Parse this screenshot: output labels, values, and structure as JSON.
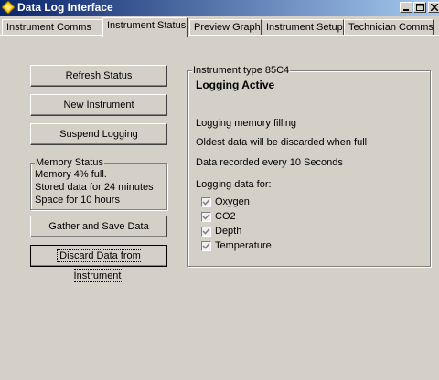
{
  "window": {
    "title": "Data Log Interface",
    "title_bar_color": "#0a246a"
  },
  "tabs": [
    {
      "label": "Instrument Comms",
      "active": false
    },
    {
      "label": "Instrument Status",
      "active": true
    },
    {
      "label": "Preview Graph",
      "active": false
    },
    {
      "label": "Instrument Setup",
      "active": false
    },
    {
      "label": "Technician Comms",
      "active": false
    }
  ],
  "buttons": {
    "refresh": "Refresh Status",
    "new_instrument": "New Instrument",
    "suspend": "Suspend Logging",
    "gather": "Gather and Save Data",
    "discard": "Discard Data from Instrument"
  },
  "memory_status": {
    "title": "Memory Status",
    "lines": [
      "Memory 4% full.",
      "Stored data for 24 minutes",
      "Space for 10 hours"
    ]
  },
  "instrument": {
    "legend": "Instrument type 85C4",
    "status": "Logging Active",
    "memory_line": "Logging memory filling",
    "discard_line": "Oldest data will be discarded when full",
    "interval_line": "Data recorded every 10 Seconds",
    "logging_for": "Logging data for:",
    "channels": [
      {
        "label": "Oxygen",
        "checked": true
      },
      {
        "label": "CO2",
        "checked": true
      },
      {
        "label": "Depth",
        "checked": true
      },
      {
        "label": "Temperature",
        "checked": true
      }
    ]
  }
}
